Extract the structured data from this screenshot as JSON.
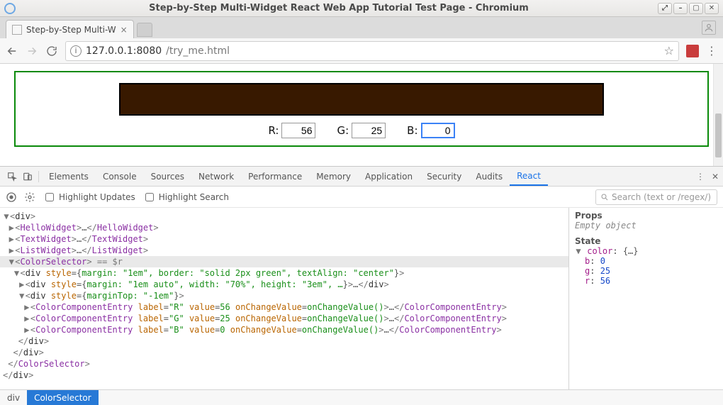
{
  "window": {
    "title": "Step-by-Step Multi-Widget React Web App Tutorial Test Page - Chromium"
  },
  "browser": {
    "tab_title": "Step-by-Step Multi-W",
    "url_host": "127.0.0.1",
    "url_port": ":8080",
    "url_path": "/try_me.html"
  },
  "page": {
    "r_label": "R:",
    "g_label": "G:",
    "b_label": "B:",
    "r_value": "56",
    "g_value": "25",
    "b_value": "0"
  },
  "devtools": {
    "tabs": [
      "Elements",
      "Console",
      "Sources",
      "Network",
      "Performance",
      "Memory",
      "Application",
      "Security",
      "Audits",
      "React"
    ],
    "active_tab": "React",
    "highlight_updates": "Highlight Updates",
    "highlight_search": "Highlight Search",
    "search_placeholder": "Search (text or /regex/)",
    "side": {
      "props_hdr": "Props",
      "props_empty": "Empty object",
      "state_hdr": "State",
      "state_key": "color",
      "state_val": "{…}",
      "b_key": "b",
      "b_val": "0",
      "g_key": "g",
      "g_val": "25",
      "r_key": "r",
      "r_val": "56"
    },
    "tree": {
      "root_open": "div",
      "hello": "HelloWidget",
      "text": "TextWidget",
      "list": "ListWidget",
      "colorsel": "ColorSelector",
      "eq_r": " == $r",
      "div_style1": "margin: \"1em\", border: \"solid 2px green\", textAlign: \"center\"",
      "div_style2_prefix": "margin: \"1em auto\", width: \"70%\", height: \"3em\", …",
      "div_style3": "marginTop: \"-1em\"",
      "cce": "ColorComponentEntry",
      "onchg": "onChangeValue",
      "onchg_fn": "onChangeValue()",
      "label_R": "\"R\"",
      "val_R": "56",
      "label_G": "\"G\"",
      "val_G": "25",
      "label_B": "\"B\"",
      "val_B": "0",
      "close_div": "div",
      "close_colorsel": "ColorSelector"
    },
    "crumbs": {
      "first": "div",
      "second": "ColorSelector"
    }
  }
}
